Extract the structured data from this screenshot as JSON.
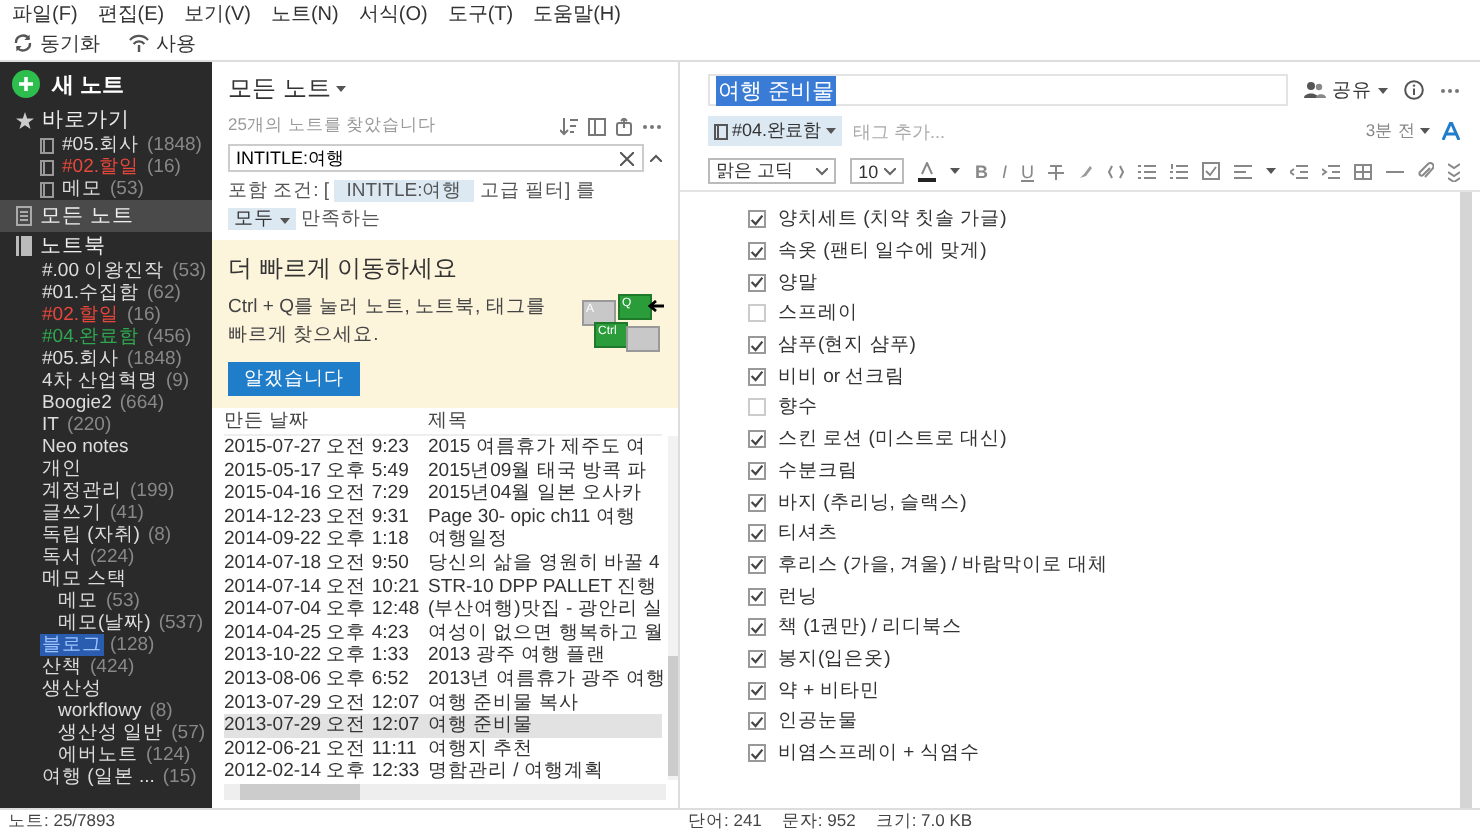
{
  "menu": [
    "파일(F)",
    "편집(E)",
    "보기(V)",
    "노트(N)",
    "서식(O)",
    "도구(T)",
    "도움말(H)"
  ],
  "toolbar": [
    {
      "label": "동기화",
      "kind": "sync"
    },
    {
      "label": "사용",
      "kind": "activity"
    }
  ],
  "sidebar": {
    "new_note": "새 노트",
    "shortcuts": {
      "label": "바로가기",
      "items": [
        {
          "name": "#05.회사",
          "count": "(1848)",
          "selected": false
        },
        {
          "name": "#02.할일",
          "count": "(16)",
          "selected": false,
          "color": "#e8473c"
        },
        {
          "name": "메모",
          "count": "(53)",
          "selected": false
        }
      ]
    },
    "all_notes": {
      "label": "모든 노트",
      "selected": true
    },
    "notebooks": {
      "label": "노트북",
      "items": [
        {
          "name": "#.00 이왕진작",
          "count": "(53)",
          "selected": false
        },
        {
          "name": "#01.수집함",
          "count": "(62)",
          "selected": false
        },
        {
          "name": "#02.할일",
          "count": "(16)",
          "selected": false,
          "color": "#e8473c"
        },
        {
          "name": "#04.완료함",
          "count": "(456)",
          "selected": false,
          "color": "#2fa84f"
        },
        {
          "name": "#05.회사",
          "count": "(1848)",
          "selected": false
        },
        {
          "name": "4차 산업혁명",
          "count": "(9)",
          "selected": false
        },
        {
          "name": "Boogie2",
          "count": "(664)",
          "selected": false
        },
        {
          "name": "IT",
          "count": "(220)",
          "selected": false
        },
        {
          "name": "Neo notes",
          "selected": false
        },
        {
          "name": "개인",
          "selected": false
        },
        {
          "name": "계정관리",
          "count": "(199)",
          "selected": false
        },
        {
          "name": "글쓰기",
          "count": "(41)",
          "selected": false
        },
        {
          "name": "독립 (자취)",
          "count": "(8)",
          "selected": false
        },
        {
          "name": "독서",
          "count": "(224)",
          "selected": false
        },
        {
          "name": "메모 스택",
          "selected": false,
          "children": [
            {
              "name": "메모",
              "count": "(53)",
              "selected": false
            },
            {
              "name": "메모(날짜)",
              "count": "(537)",
              "selected": false
            }
          ]
        },
        {
          "name": "블로그",
          "count": "(128)",
          "selected": true
        },
        {
          "name": "산책",
          "count": "(424)",
          "selected": false
        },
        {
          "name": "생산성",
          "selected": false,
          "children": [
            {
              "name": "workflowy",
              "count": "(8)",
              "selected": false
            },
            {
              "name": "생산성 일반",
              "count": "(57)",
              "selected": false
            },
            {
              "name": "에버노트",
              "count": "(124)",
              "selected": false
            }
          ]
        },
        {
          "name": "여행 (일본 ...",
          "count": "(15)",
          "selected": false
        }
      ]
    }
  },
  "list": {
    "title": "모든 노트",
    "found": "25개의 노트를 찾았습니다",
    "search": "INTITLE:여행",
    "filter_label": "포함 조건:",
    "filter_open": "[",
    "filter_chip": "INTITLE:여행",
    "filter_rest": "고급 필터] 를",
    "match_mode": "모두",
    "match_text": "만족하는",
    "tip": {
      "title": "더 빠르게 이동하세요",
      "text": "Ctrl + Q를 눌러 노트, 노트북, 태그를 빠르게 찾으세요.",
      "button": "알겠습니다",
      "keys": [
        {
          "label": "A",
          "pressed": false
        },
        {
          "label": "Q",
          "pressed": true
        },
        {
          "label": "Ctrl",
          "pressed": true
        }
      ]
    },
    "columns": [
      "만든 날짜",
      "제목"
    ],
    "rows": [
      {
        "created": "2015-07-27 오전 9:23",
        "title": "2015 여름휴가 제주도 여",
        "selected": false
      },
      {
        "created": "2015-05-17 오후 5:49",
        "title": "2015년09월 태국 방콕 파",
        "selected": false
      },
      {
        "created": "2015-04-16 오전 7:29",
        "title": "2015년04월 일본 오사카",
        "selected": false
      },
      {
        "created": "2014-12-23 오전 9:31",
        "title": "Page 30- opic ch11 여행",
        "selected": false
      },
      {
        "created": "2014-09-22 오후 1:18",
        "title": "여행일정",
        "selected": false
      },
      {
        "created": "2014-07-18 오전 9:50",
        "title": "당신의 삶을 영원히 바꿀 4",
        "selected": false
      },
      {
        "created": "2014-07-14 오전 10:21",
        "title": "STR-10 DPP PALLET 진행",
        "selected": false
      },
      {
        "created": "2014-07-04 오후 12:48",
        "title": "(부산여행)맛집 - 광안리 실",
        "selected": false
      },
      {
        "created": "2014-04-25 오후 4:23",
        "title": "여성이 없으면 행복하고 월",
        "selected": false
      },
      {
        "created": "2013-10-22 오후 1:33",
        "title": "2013 광주 여행 플랜",
        "selected": false
      },
      {
        "created": "2013-08-06 오후 6:52",
        "title": "2013년 여름휴가 광주 여행",
        "selected": false
      },
      {
        "created": "2013-07-29 오전 12:07",
        "title": "여행 준비물 복사",
        "selected": false
      },
      {
        "created": "2013-07-29 오전 12:07",
        "title": "여행 준비물",
        "selected": true
      },
      {
        "created": "2012-06-21 오전 11:11",
        "title": "여행지 추천",
        "selected": false
      },
      {
        "created": "2012-02-14 오후 12:33",
        "title": "명함관리 / 여행계획",
        "selected": false
      }
    ]
  },
  "note": {
    "title": "여행 준비물",
    "share": "공유",
    "notebook": "#04.완료함",
    "tag_placeholder": "태그 추가...",
    "updated": "3분 전",
    "font": "맑은 고딕",
    "font_size": "10",
    "format_letters": [
      "B",
      "I",
      "U"
    ],
    "checklist": [
      {
        "text": "양치세트 (치약 칫솔 가글)",
        "checked": true
      },
      {
        "text": "속옷 (팬티 일수에 맞게)",
        "checked": true
      },
      {
        "text": "양말",
        "checked": true
      },
      {
        "text": "스프레이",
        "checked": false
      },
      {
        "text": "샴푸(현지 샴푸)",
        "checked": true
      },
      {
        "text": "비비 or 선크림",
        "checked": true
      },
      {
        "text": "향수",
        "checked": false
      },
      {
        "text": "스킨 로션 (미스트로 대신)",
        "checked": true
      },
      {
        "text": "수분크림",
        "checked": true
      },
      {
        "text": "바지 (추리닝, 슬랙스)",
        "checked": true
      },
      {
        "text": "티셔츠",
        "checked": true
      },
      {
        "text": "후리스 (가을, 겨울) / 바람막이로 대체",
        "checked": true
      },
      {
        "text": "런닝",
        "checked": true
      },
      {
        "text": "책 (1권만) / 리디북스",
        "checked": true
      },
      {
        "text": "봉지(입은옷)",
        "checked": true
      },
      {
        "text": "약 + 비타민",
        "checked": true
      },
      {
        "text": "인공눈물",
        "checked": true
      },
      {
        "text": "비염스프레이 + 식염수",
        "checked": true
      }
    ]
  },
  "status_bar": {
    "notes": "노트: 25/7893",
    "words": "단어: 241",
    "chars": "문자: 952",
    "size": "크기: 7.0 KB"
  }
}
